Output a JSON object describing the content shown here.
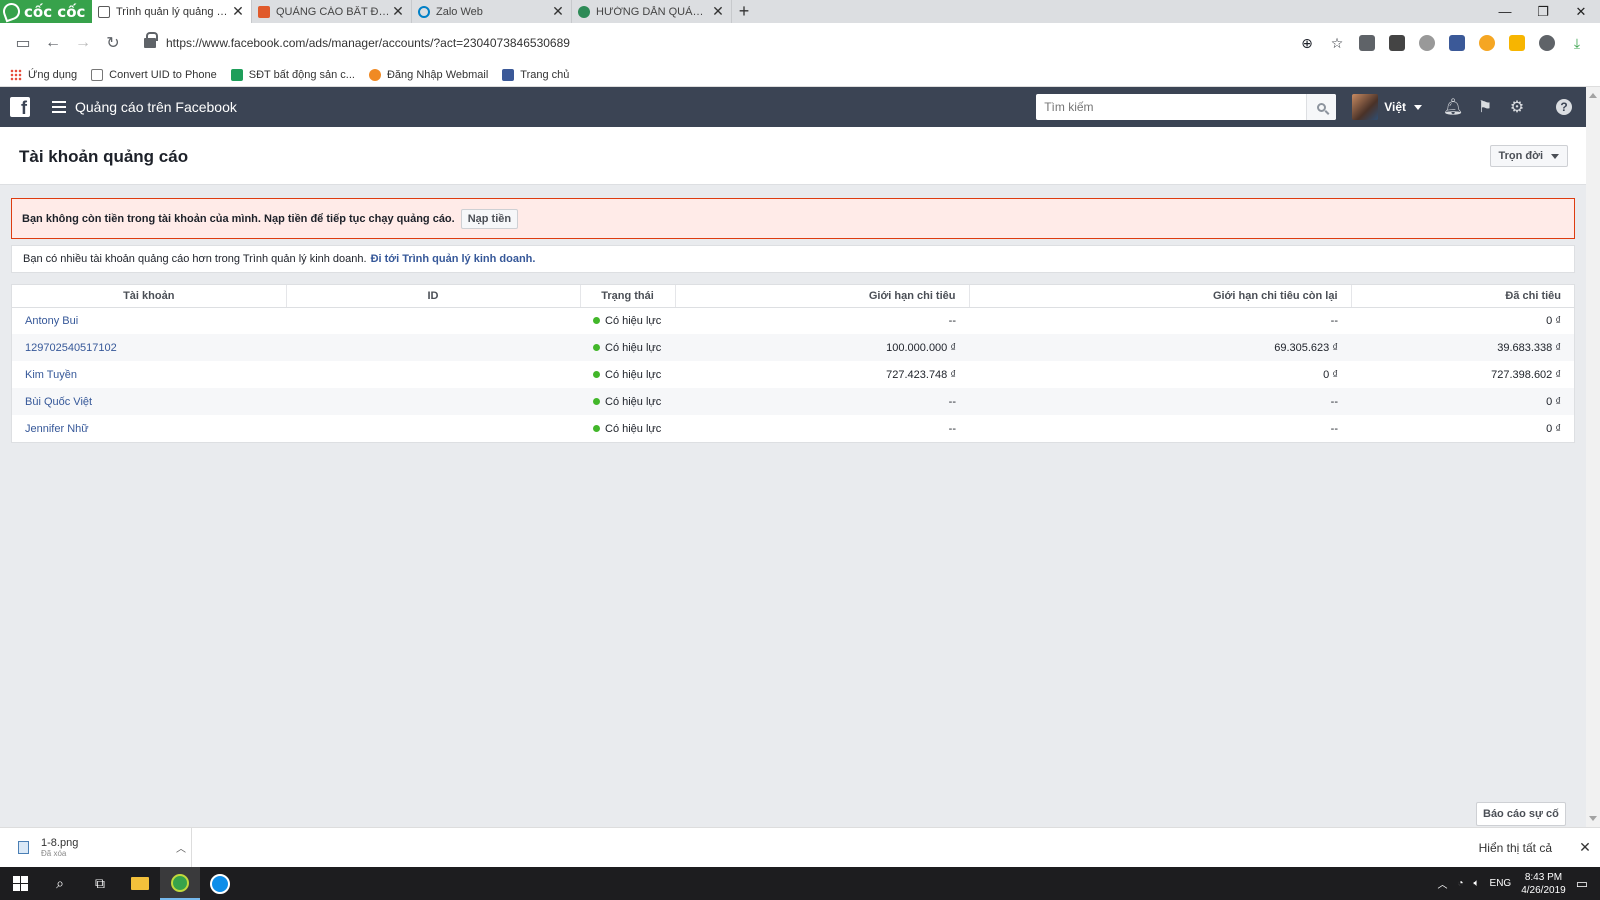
{
  "browser": {
    "logo_text": "cốc cốc",
    "tabs": [
      {
        "title": "Trình quản lý quảng cáo",
        "favicon_color": "#5a5a5a",
        "active": true
      },
      {
        "title": "QUẢNG CÁO BẤT ĐỘNG",
        "favicon_color": "#e05a2b",
        "active": false
      },
      {
        "title": "Zalo Web",
        "favicon_color": "#0180c7",
        "active": false
      },
      {
        "title": "HƯỚNG DẪN QUẢNG CÁ",
        "favicon_color": "#2e8b57",
        "active": false
      }
    ],
    "url": "https://www.facebook.com/ads/manager/accounts/?act=2304073846530689",
    "bookmarks": [
      {
        "label": "Ứng dụng"
      },
      {
        "label": "Convert UID to Phone"
      },
      {
        "label": "SĐT bất động sản c..."
      },
      {
        "label": "Đăng Nhập Webmail"
      },
      {
        "label": "Trang chủ"
      }
    ]
  },
  "fb": {
    "logo": "f",
    "title": "Quảng cáo trên Facebook",
    "search_placeholder": "Tìm kiếm",
    "user_name": "Việt",
    "brand_color": "#3b4454"
  },
  "page": {
    "title": "Tài khoản quảng cáo",
    "range_label": "Trọn đời",
    "alert_text": "Bạn không còn tiền trong tài khoản của mình. Nạp tiền để tiếp tục chạy quảng cáo.",
    "alert_button": "Nạp tiền",
    "info_text": "Bạn có nhiều tài khoản quảng cáo hơn trong Trình quản lý kinh doanh.",
    "info_link": "Đi tới Trình quản lý kinh doanh."
  },
  "table": {
    "headers": {
      "account": "Tài khoản",
      "id": "ID",
      "status": "Trạng thái",
      "limit": "Giới hạn chi tiêu",
      "remaining": "Giới hạn chi tiêu còn lại",
      "spent": "Đã chi tiêu"
    },
    "rows": [
      {
        "account": "Antony Bui",
        "id": "",
        "status": "Có hiệu lực",
        "limit": "--",
        "remaining": "--",
        "spent": "0 ₫"
      },
      {
        "account": "129702540517102",
        "id": "",
        "status": "Có hiệu lực",
        "limit": "100.000.000 ₫",
        "remaining": "69.305.623 ₫",
        "spent": "39.683.338 ₫"
      },
      {
        "account": "Kim Tuyền",
        "id": "",
        "status": "Có hiệu lực",
        "limit": "727.423.748 ₫",
        "remaining": "0 ₫",
        "spent": "727.398.602 ₫"
      },
      {
        "account": "Bùi Quốc Việt",
        "id": "",
        "status": "Có hiệu lực",
        "limit": "--",
        "remaining": "--",
        "spent": "0 ₫"
      },
      {
        "account": "Jennifer Nhữ",
        "id": "",
        "status": "Có hiệu lực",
        "limit": "--",
        "remaining": "--",
        "spent": "0 ₫"
      }
    ]
  },
  "report_button": "Báo cáo sự cố",
  "download_bar": {
    "file_name": "1-8.png",
    "file_status": "Đã xóa",
    "show_all": "Hiển thị tất cả"
  },
  "taskbar": {
    "lang": "ENG",
    "time": "8:43 PM",
    "date": "4/26/2019"
  }
}
